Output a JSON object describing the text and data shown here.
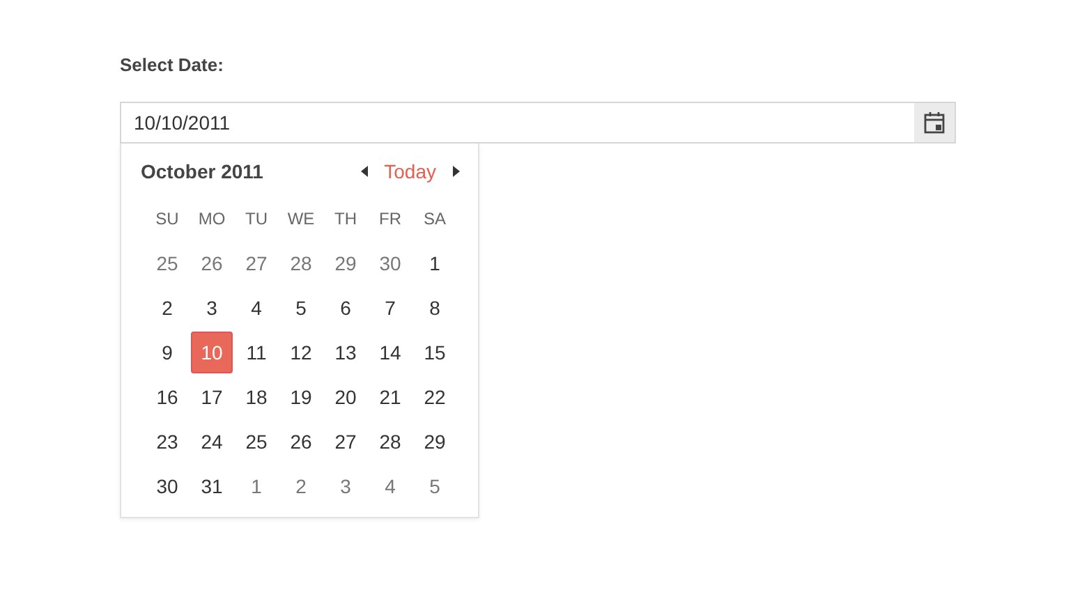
{
  "label": "Select Date:",
  "date_field": {
    "value": "10/10/2011"
  },
  "calendar": {
    "month_title": "October 2011",
    "today": "Today",
    "weekdays": [
      "SU",
      "MO",
      "TU",
      "WE",
      "TH",
      "FR",
      "SA"
    ],
    "weeks": [
      [
        {
          "day": "25",
          "other_month": true,
          "selected": false
        },
        {
          "day": "26",
          "other_month": true,
          "selected": false
        },
        {
          "day": "27",
          "other_month": true,
          "selected": false
        },
        {
          "day": "28",
          "other_month": true,
          "selected": false
        },
        {
          "day": "29",
          "other_month": true,
          "selected": false
        },
        {
          "day": "30",
          "other_month": true,
          "selected": false
        },
        {
          "day": "1",
          "other_month": false,
          "selected": false
        }
      ],
      [
        {
          "day": "2",
          "other_month": false,
          "selected": false
        },
        {
          "day": "3",
          "other_month": false,
          "selected": false
        },
        {
          "day": "4",
          "other_month": false,
          "selected": false
        },
        {
          "day": "5",
          "other_month": false,
          "selected": false
        },
        {
          "day": "6",
          "other_month": false,
          "selected": false
        },
        {
          "day": "7",
          "other_month": false,
          "selected": false
        },
        {
          "day": "8",
          "other_month": false,
          "selected": false
        }
      ],
      [
        {
          "day": "9",
          "other_month": false,
          "selected": false
        },
        {
          "day": "10",
          "other_month": false,
          "selected": true
        },
        {
          "day": "11",
          "other_month": false,
          "selected": false
        },
        {
          "day": "12",
          "other_month": false,
          "selected": false
        },
        {
          "day": "13",
          "other_month": false,
          "selected": false
        },
        {
          "day": "14",
          "other_month": false,
          "selected": false
        },
        {
          "day": "15",
          "other_month": false,
          "selected": false
        }
      ],
      [
        {
          "day": "16",
          "other_month": false,
          "selected": false
        },
        {
          "day": "17",
          "other_month": false,
          "selected": false
        },
        {
          "day": "18",
          "other_month": false,
          "selected": false
        },
        {
          "day": "19",
          "other_month": false,
          "selected": false
        },
        {
          "day": "20",
          "other_month": false,
          "selected": false
        },
        {
          "day": "21",
          "other_month": false,
          "selected": false
        },
        {
          "day": "22",
          "other_month": false,
          "selected": false
        }
      ],
      [
        {
          "day": "23",
          "other_month": false,
          "selected": false
        },
        {
          "day": "24",
          "other_month": false,
          "selected": false
        },
        {
          "day": "25",
          "other_month": false,
          "selected": false
        },
        {
          "day": "26",
          "other_month": false,
          "selected": false
        },
        {
          "day": "27",
          "other_month": false,
          "selected": false
        },
        {
          "day": "28",
          "other_month": false,
          "selected": false
        },
        {
          "day": "29",
          "other_month": false,
          "selected": false
        }
      ],
      [
        {
          "day": "30",
          "other_month": false,
          "selected": false
        },
        {
          "day": "31",
          "other_month": false,
          "selected": false
        },
        {
          "day": "1",
          "other_month": true,
          "selected": false
        },
        {
          "day": "2",
          "other_month": true,
          "selected": false
        },
        {
          "day": "3",
          "other_month": true,
          "selected": false
        },
        {
          "day": "4",
          "other_month": true,
          "selected": false
        },
        {
          "day": "5",
          "other_month": true,
          "selected": false
        }
      ]
    ]
  }
}
